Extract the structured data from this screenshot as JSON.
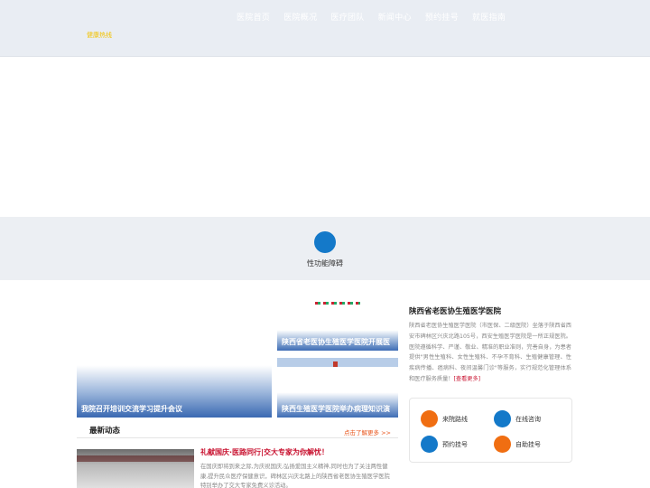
{
  "nav": {
    "items": [
      "医院首页",
      "医院概况",
      "医疗团队",
      "新闻中心",
      "预约挂号",
      "就医指南"
    ]
  },
  "header": {
    "tagline": "健康热线"
  },
  "services": {
    "item_label": "性功能障碍"
  },
  "news_cards": [
    {
      "caption": "我院召开培训交流学习提升会议"
    },
    {
      "caption": "陕西省老医协生殖医学医院开展医"
    },
    {
      "caption": "陕西生殖医学医院举办病理知识演"
    }
  ],
  "hospital": {
    "title": "陕西省老医协生殖医学医院",
    "description": "陕西省老医协生殖医学医院（市医保、二级医院）坐落于陕西省西安市碑林区兴庆北路105号，西安生殖医学医院是一所正规医院。医院遵循科学、严谨、敬业、精准的职业准则，完善自身，为患者提供\"男性生殖科、女性生殖科、不孕不育科、生殖健康管理、性疾病传播、癌病科、夜间温馨门诊\"等服务，实行规范化管理体系和医疗服务质量！",
    "more_label": "[查看更多]"
  },
  "quick_links": [
    {
      "label": "来院路线",
      "color": "#f06e12"
    },
    {
      "label": "在线咨询",
      "color": "#1479c9"
    },
    {
      "label": "预约挂号",
      "color": "#1479c9"
    },
    {
      "label": "自助挂号",
      "color": "#f06e12"
    }
  ],
  "latest": {
    "title": "最新动态",
    "more_label": "点击了解更多 >>",
    "item_title": "礼献国庆·医路同行|交大专家为你解忧！",
    "item_text": "在国庆即将到来之际,为庆祝国庆,弘扬爱国主义精神,同时也为了关注两性健康,提升民众医疗保健意识，碑林区兴庆北路上的陕西省老医协生殖医学医院特别举办了交大专家免费义诊活动。"
  }
}
